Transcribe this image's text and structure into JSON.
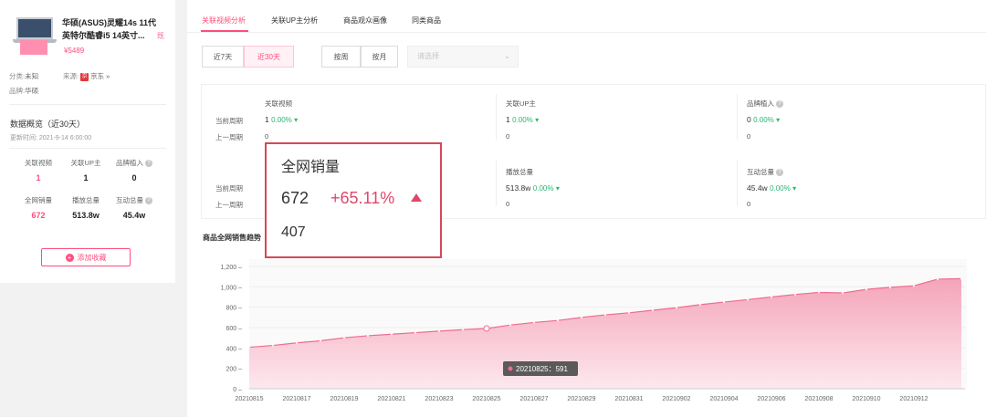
{
  "product": {
    "title": "华硕(ASUS)灵耀14s 11代英特尔酷睿i5 14英寸...",
    "tag": "既",
    "price": "¥5489",
    "category_label": "分类:",
    "category_value": "未知",
    "source_label": "来源:",
    "source_badge": "京",
    "source_value": "京东 »",
    "brand_label": "品牌:",
    "brand_value": "华硕"
  },
  "overview": {
    "title": "数据概览（近30天）",
    "update_time": "更新时间: 2021-9-14 6:00:00",
    "stats": [
      {
        "label": "关联视频",
        "value": "1",
        "highlight": true,
        "help": false
      },
      {
        "label": "关联UP主",
        "value": "1",
        "highlight": false,
        "help": false
      },
      {
        "label": "品牌植入",
        "value": "0",
        "highlight": false,
        "help": true
      },
      {
        "label": "全网销量",
        "value": "672",
        "highlight": true,
        "help": false
      },
      {
        "label": "播放总量",
        "value": "513.8w",
        "highlight": false,
        "help": false
      },
      {
        "label": "互动总量",
        "value": "45.4w",
        "highlight": false,
        "help": true
      }
    ],
    "help_glyph": "?",
    "favorite_button": "添加收藏",
    "plus_glyph": "+"
  },
  "tabs": [
    {
      "label": "关联视频分析",
      "active": true
    },
    {
      "label": "关联UP主分析",
      "active": false
    },
    {
      "label": "商品观众画像",
      "active": false
    },
    {
      "label": "同类商品",
      "active": false
    }
  ],
  "filters": {
    "range_7": "近7天",
    "range_30": "近30天",
    "by_week": "按周",
    "by_month": "按月",
    "select_placeholder": "请选择",
    "chevron": "⌄"
  },
  "metrics": {
    "current_label": "当前周期",
    "previous_label": "上一周期",
    "arrow": "▾",
    "row1": [
      {
        "label": "关联视频",
        "value": "1",
        "pct": "0.00%",
        "prev": "0",
        "help": false
      },
      {
        "label": "关联UP主",
        "value": "1",
        "pct": "0.00%",
        "prev": "0",
        "help": false
      },
      {
        "label": "品牌植入",
        "value": "0",
        "pct": "0.00%",
        "prev": "0",
        "help": true
      }
    ],
    "row2": [
      {
        "label": "播放总量",
        "value": "513.8w",
        "pct": "0.00%",
        "prev": "0",
        "help": false
      },
      {
        "label": "互动总量",
        "value": "45.4w",
        "pct": "0.00%",
        "prev": "0",
        "help": true
      }
    ]
  },
  "sales_tooltip": {
    "title": "全网销量",
    "value": "672",
    "change": "+65.11%",
    "previous": "407"
  },
  "chart_title": "商品全网销售趋势",
  "chart_data": {
    "type": "area",
    "title": "商品全网销售趋势",
    "x": [
      "20210815",
      "20210816",
      "20210817",
      "20210818",
      "20210819",
      "20210820",
      "20210821",
      "20210822",
      "20210823",
      "20210824",
      "20210825",
      "20210826",
      "20210827",
      "20210828",
      "20210829",
      "20210830",
      "20210831",
      "20210901",
      "20210902",
      "20210903",
      "20210904",
      "20210905",
      "20210906",
      "20210907",
      "20210908",
      "20210909",
      "20210910",
      "20210911",
      "20210912",
      "20210913"
    ],
    "x_tick_labels": [
      "20210815",
      "20210817",
      "20210819",
      "20210821",
      "20210823",
      "20210825",
      "20210827",
      "20210829",
      "20210831",
      "20210902",
      "20210904",
      "20210906",
      "20210908",
      "20210910",
      "20210912"
    ],
    "values": [
      407,
      425,
      450,
      470,
      500,
      520,
      535,
      550,
      565,
      580,
      591,
      625,
      650,
      670,
      700,
      725,
      745,
      770,
      795,
      825,
      850,
      875,
      900,
      925,
      945,
      940,
      975,
      995,
      1010,
      1075,
      1080
    ],
    "ylim": [
      0,
      1200
    ],
    "yticks": [
      0,
      200,
      400,
      600,
      800,
      1000,
      1200
    ],
    "ytick_labels": [
      "0",
      "200",
      "400",
      "600",
      "800",
      "1,000",
      "1,200"
    ],
    "highlight": {
      "x": "20210825",
      "value": 591,
      "label": "20210825：591"
    },
    "color": "#f06b8f",
    "fill_top": "#f4a0b6",
    "fill_bottom": "#fde7ee"
  }
}
